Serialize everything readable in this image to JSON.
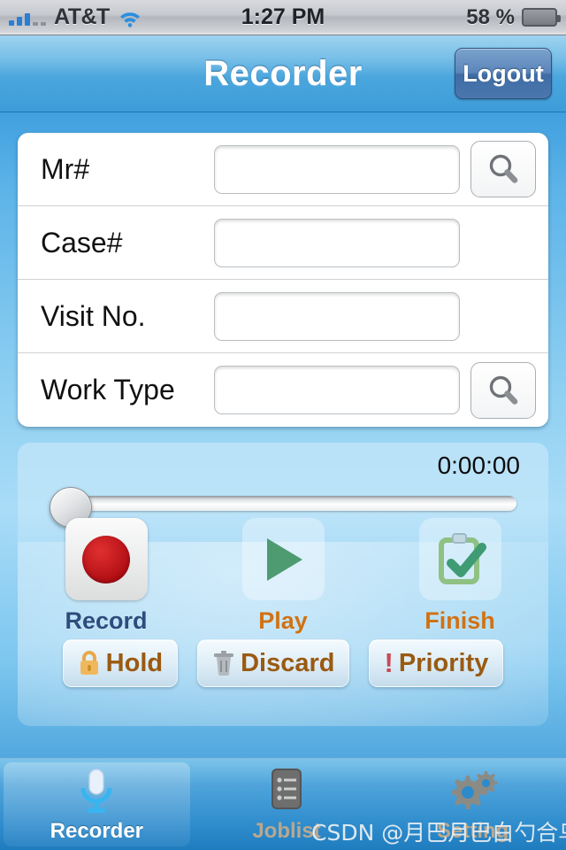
{
  "statusbar": {
    "carrier": "AT&T",
    "time": "1:27 PM",
    "battery_percent": "58 %",
    "battery_level": 58,
    "signal_icon": "signal-bars-icon",
    "wifi_icon": "wifi-icon",
    "battery_icon": "battery-icon"
  },
  "navbar": {
    "title": "Recorder",
    "logout_label": "Logout"
  },
  "form": {
    "rows": [
      {
        "label": "Mr#",
        "value": "",
        "placeholder": "",
        "has_search": true
      },
      {
        "label": "Case#",
        "value": "",
        "placeholder": "",
        "has_search": false
      },
      {
        "label": "Visit No.",
        "value": "",
        "placeholder": "",
        "has_search": false
      },
      {
        "label": "Work Type",
        "value": "",
        "placeholder": "",
        "has_search": true
      }
    ],
    "search_icon": "magnifier-icon"
  },
  "player": {
    "timer": "0:00:00",
    "slider_value": 0,
    "primary_buttons": [
      {
        "label": "Record",
        "icon": "record-dot-icon"
      },
      {
        "label": "Play",
        "icon": "play-triangle-icon"
      },
      {
        "label": "Finish",
        "icon": "clipboard-check-icon"
      }
    ],
    "secondary_buttons": [
      {
        "label": "Hold",
        "icon": "lock-icon"
      },
      {
        "label": "Discard",
        "icon": "trash-icon"
      },
      {
        "label": "Priority",
        "icon": "exclamation-icon"
      }
    ]
  },
  "tabbar": {
    "tabs": [
      {
        "label": "Recorder",
        "icon": "microphone-icon",
        "active": true
      },
      {
        "label": "Joblist",
        "icon": "list-document-icon",
        "active": false
      },
      {
        "label": "Setting",
        "icon": "gears-icon",
        "active": false
      }
    ]
  },
  "watermark": "CSDN @月巴月巴白勺合鸟月半",
  "colors": {
    "accent_blue": "#2d8bcc",
    "record_red": "#b10e14",
    "play_green": "#4e9b72",
    "label_orange": "#cf7216",
    "label_navy": "#2d4d7d",
    "button_brown": "#9a5a12"
  }
}
